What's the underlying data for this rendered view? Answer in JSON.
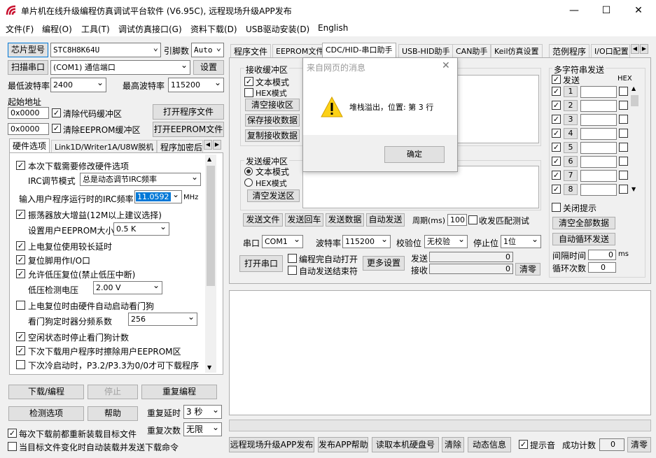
{
  "window": {
    "title": "单片机在线升级编程仿真调试平台软件 (V6.95C), 远程现场升级APP发布",
    "minimize": "—",
    "maximize": "☐",
    "close": "✕"
  },
  "menu": [
    "文件(F)",
    "编程(O)",
    "工具(T)",
    "调试仿真接口(G)",
    "资料下载(D)",
    "USB驱动安装(D)",
    "English"
  ],
  "left": {
    "chip_btn": "芯片型号",
    "chip_value": "STC8H8K64U",
    "pin_label": "引脚数",
    "pin_value": "Auto",
    "scan_btn": "扫描串口",
    "port_value": "(COM1) 通信端口",
    "settings_btn": "设置",
    "min_baud_label": "最低波特率",
    "min_baud_value": "2400",
    "max_baud_label": "最高波特率",
    "max_baud_value": "115200",
    "start_addr_label": "起始地址",
    "addr1": "0x0000",
    "clear_code_label": "清除代码缓冲区",
    "open_prog_btn": "打开程序文件",
    "addr2": "0x0000",
    "clear_eeprom_label": "清除EEPROM缓冲区",
    "open_eeprom_btn": "打开EEPROM文件",
    "tabs": [
      "硬件选项",
      "Link1D/Writer1A/U8W脱机",
      "程序加密后"
    ],
    "options": {
      "need_modify": "本次下载需要修改硬件选项",
      "irc_mode_label": "IRC调节模式",
      "irc_mode_value": "总是动态调节IRC频率",
      "irc_freq_label": "输入用户程序运行时的IRC频率",
      "irc_freq_value": "11.0592",
      "irc_freq_unit": "MHz",
      "osc_amp": "振荡器放大增益(12M以上建议选择)",
      "eeprom_size_label": "设置用户EEPROM大小",
      "eeprom_size_value": "0.5 K",
      "long_reset": "上电复位使用较长延时",
      "reset_pin": "复位脚用作I/O口",
      "lvd_reset": "允许低压复位(禁止低压中断)",
      "lvd_label": "低压检测电压",
      "lvd_value": "2.00 V",
      "wdt_start": "上电复位时由硬件自动启动看门狗",
      "wdt_div_label": "看门狗定时器分频系数",
      "wdt_div_value": "256",
      "idle_wdt": "空闲状态时停止看门狗计数",
      "erase_eeprom": "下次下载用户程序时擦除用户EEPROM区",
      "cold_boot": "下次冷启动时，P3.2/P3.3为0/0才可下载程序"
    },
    "download_btn": "下载/编程",
    "stop_btn": "停止",
    "reprog_btn": "重复编程",
    "check_btn": "检测选项",
    "help_btn": "帮助",
    "repeat_delay_label": "重复延时",
    "repeat_delay_value": "3 秒",
    "repeat_count_label": "重复次数",
    "repeat_count_value": "无限",
    "reload_each": "每次下载前都重新装载目标文件",
    "auto_send": "当目标文件变化时自动装载并发送下载命令"
  },
  "right": {
    "tabs": [
      "程序文件",
      "EEPROM文件",
      "CDC/HID-串口助手",
      "USB-HID助手",
      "CAN助手",
      "Keil仿真设置",
      "范例程序",
      "I/O口配置"
    ],
    "recv_group": "接收缓冲区",
    "text_mode": "文本模式",
    "hex_mode": "HEX模式",
    "clear_recv": "清空接收区",
    "save_recv": "保存接收数据",
    "copy_recv": "复制接收数据",
    "send_group": "发送缓冲区",
    "send_text_mode": "文本模式",
    "send_hex_mode": "HEX模式",
    "clear_send": "清空发送区",
    "send_file": "发送文件",
    "send_return": "发送回车",
    "send_data": "发送数据",
    "auto_send": "自动发送",
    "period_label": "周期(ms)",
    "period_value": "100",
    "match_label": "收发匹配测试",
    "port_label": "串口",
    "port_value": "COM1",
    "baud_label": "波特率",
    "baud_value": "115200",
    "parity_label": "校验位",
    "parity_value": "无校验",
    "stop_label": "停止位",
    "stop_value": "1位",
    "open_port": "打开串口",
    "open_on_prog": "编程完自动打开",
    "close_on_send": "自动发送结束符",
    "more_settings": "更多设置",
    "sent_label": "发送",
    "sent_value": "0",
    "recv_label": "接收",
    "recv_value": "0",
    "clear_counts": "清零",
    "multi": {
      "title": "多字符串发送",
      "send_label": "发送",
      "hex_label": "HEX",
      "rows": [
        "1",
        "2",
        "3",
        "4",
        "5",
        "6",
        "7",
        "8"
      ],
      "close_hint": "关闭提示",
      "clear_all": "清空全部数据",
      "auto_loop": "自动循环发送",
      "interval_label": "间隔时间",
      "interval_value": "0",
      "interval_unit": "ms",
      "loop_label": "循环次数",
      "loop_value": "0"
    }
  },
  "dialog": {
    "title": "来自网页的消息",
    "message": "堆栈溢出，位置: 第 3 行",
    "ok": "确定"
  },
  "bottom": {
    "publish": "远程现场升级APP发布",
    "publish_help": "发布APP帮助",
    "read_disk": "读取本机硬盘号",
    "clear": "清除",
    "dynamic": "动态信息",
    "beep": "提示音",
    "success_label": "成功计数",
    "success_value": "0",
    "reset": "清零"
  }
}
